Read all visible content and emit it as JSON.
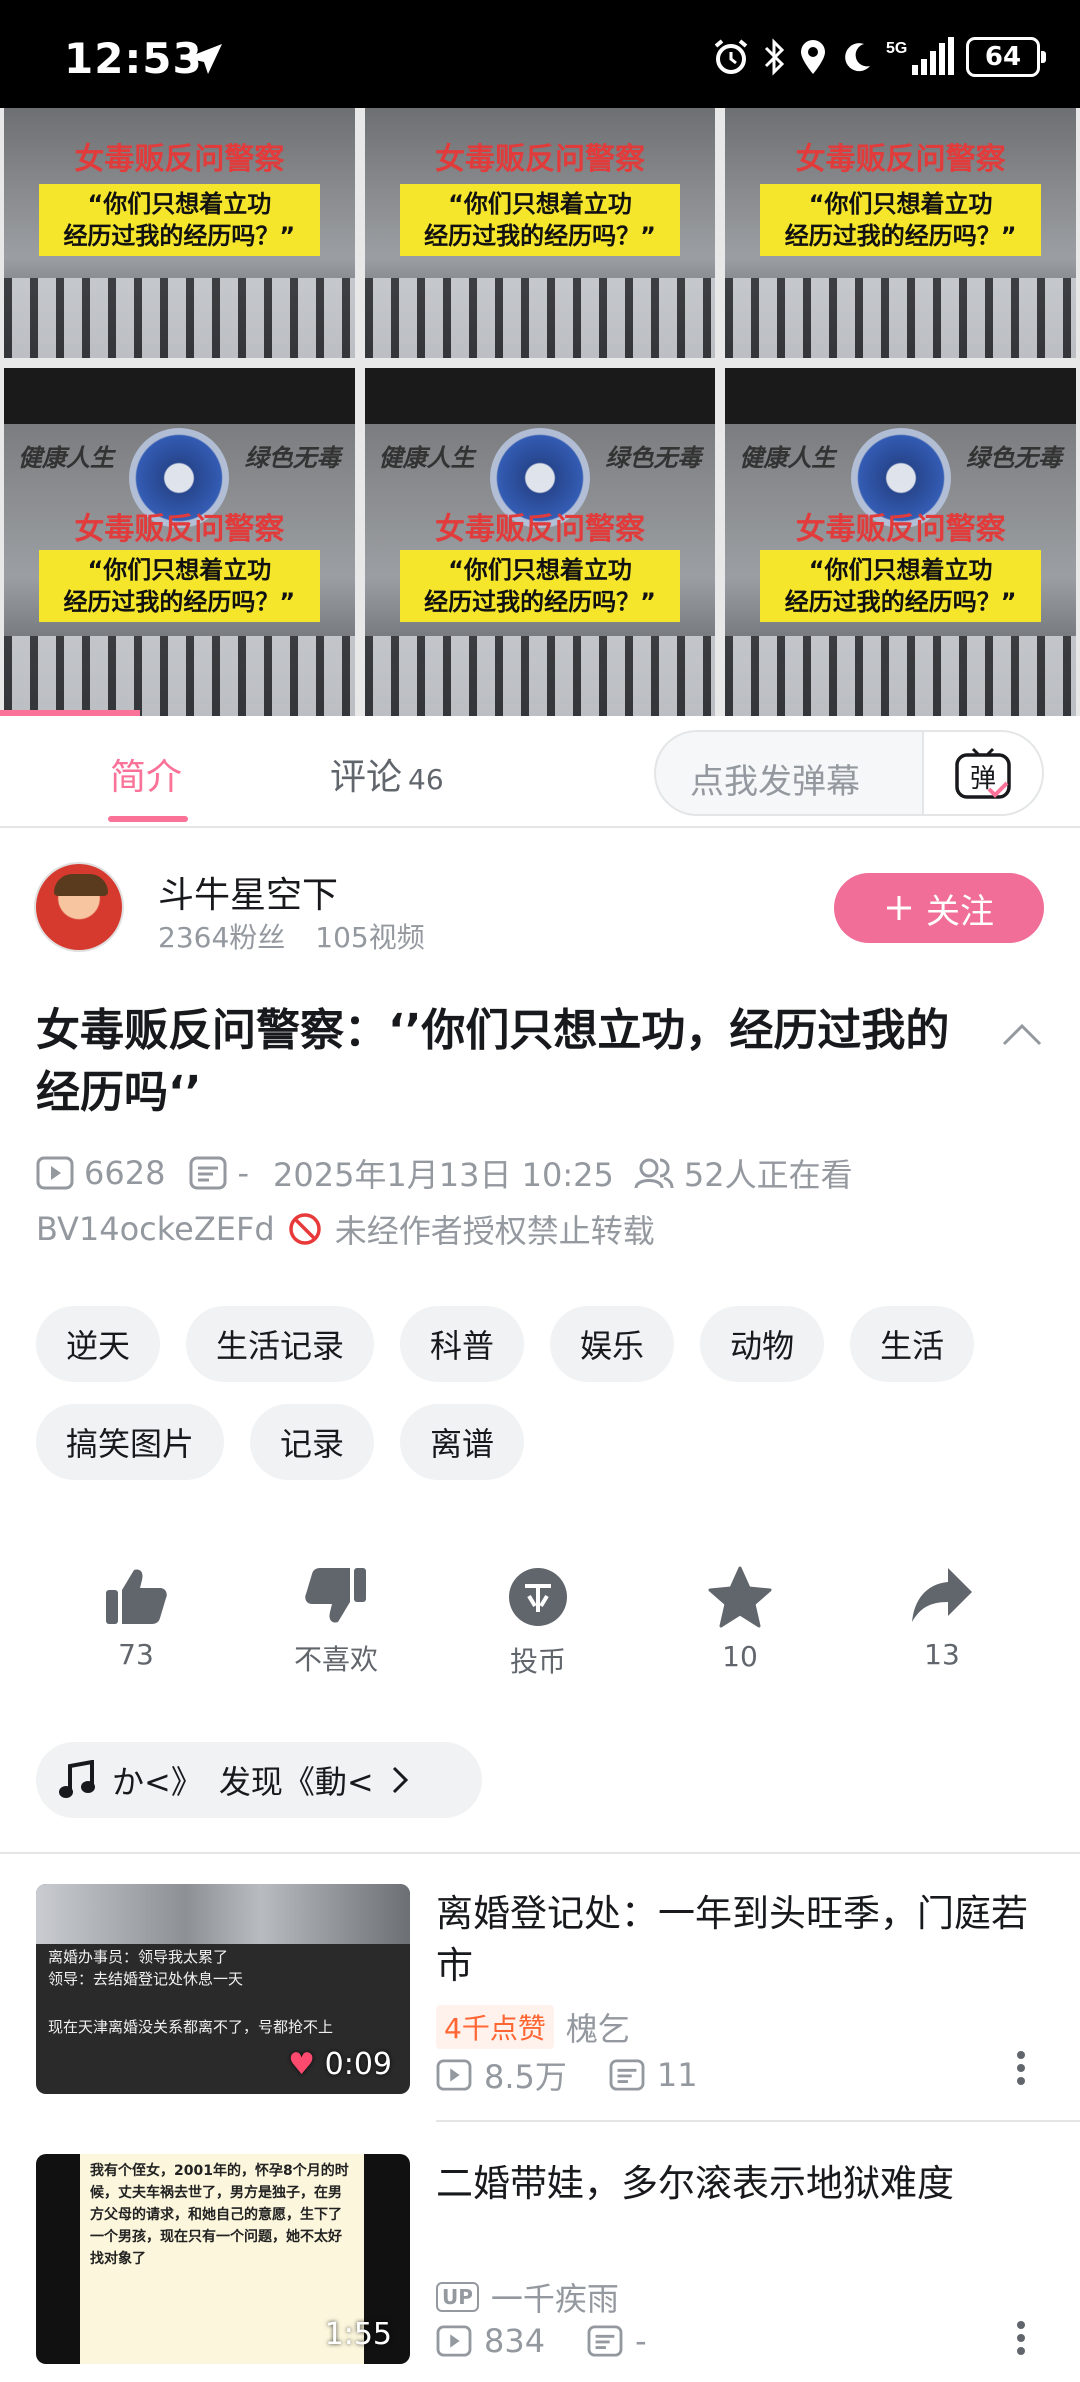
{
  "status_bar": {
    "time": "12:53",
    "battery": "64"
  },
  "video": {
    "frame_title": "女毒贩反问警察",
    "frame_quote_line1": "“你们只想着立功",
    "frame_quote_line2": "经历过我的经历吗？”",
    "slogan_left": "健康人生",
    "slogan_right": "绿色无毒",
    "accent_color": "#fb7299"
  },
  "tabs": {
    "intro": "简介",
    "comments": "评论",
    "comments_count": "46",
    "danmaku_placeholder": "点我发弹幕",
    "danmaku_button": "弹"
  },
  "uploader": {
    "name": "斗牛星空下",
    "fans": "2364粉丝",
    "videos": "105视频",
    "follow_label": "关注"
  },
  "video_info": {
    "title": "女毒贩反问警察：‘’你们只想立功，经历过我的经历吗‘’",
    "views": "6628",
    "danmaku": "-",
    "date": "2025年1月13日 10:25",
    "watching": "52人正在看",
    "bvid": "BV14ockeZEFd",
    "copyright": "未经作者授权禁止转载"
  },
  "tags": [
    "逆天",
    "生活记录",
    "科普",
    "娱乐",
    "动物",
    "生活",
    "搞笑图片",
    "记录",
    "离谱"
  ],
  "actions": {
    "like": "73",
    "dislike": "不喜欢",
    "coin": "投币",
    "favorite": "10",
    "share": "13"
  },
  "music": {
    "text": "か<》　发现《動<"
  },
  "recommendations": [
    {
      "title": "离婚登记处：一年到头旺季，门庭若市",
      "duration": "0:09",
      "badge": "4千点赞",
      "author": "槐乞",
      "views": "8.5万",
      "danmaku": "11",
      "thumb_lines": [
        "离婚办事员：领导我太累了",
        "领导：去结婚登记处休息一天",
        "现在天津离婚没关系都离不了，号都抢不上"
      ]
    },
    {
      "title": "二婚带娃，多尔滚表示地狱难度",
      "duration": "1:55",
      "author_badge": "UP",
      "author": "一千疾雨",
      "views": "834",
      "danmaku": "-",
      "thumb_text": "我有个侄女，2001年的，怀孕8个月的时候，丈夫车祸去世了，男方是独子，在男方父母的请求，和她自己的意愿，生下了一个男孩，现在只有一个问题，她不太好找对象了"
    }
  ]
}
